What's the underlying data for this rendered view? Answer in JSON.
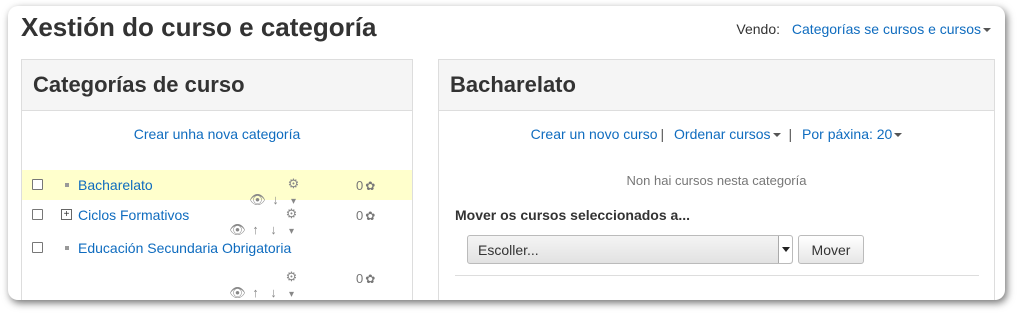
{
  "page": {
    "title": "Xestión do curso e categoría",
    "viewing_label": "Vendo:",
    "viewing_value": "Categorías se cursos e cursos"
  },
  "categories_panel": {
    "heading": "Categorías de curso",
    "create_link": "Crear unha nova categoría",
    "items": [
      {
        "name": "Bacharelato",
        "count": "0",
        "active": true,
        "expandable": false
      },
      {
        "name": "Ciclos Formativos",
        "count": "0",
        "active": false,
        "expandable": true
      },
      {
        "name": "Educación Secundaria Obrigatoria",
        "count": "0",
        "active": false,
        "expandable": false
      }
    ]
  },
  "courses_panel": {
    "heading": "Bacharelato",
    "create_course_link": "Crear un novo curso",
    "sort_courses_link": "Ordenar cursos",
    "per_page_link": "Por páxina: 20",
    "separator": "|",
    "empty_message": "Non hai cursos nesta categoría",
    "move_label": "Mover os cursos seleccionados a...",
    "select_value": "Escoller...",
    "move_button": "Mover"
  },
  "icons": {
    "show": "eye-icon",
    "up": "arrow-up-icon",
    "down": "arrow-down-icon",
    "settings": "gear-icon",
    "course_count": "courses-icon",
    "expand": "plus-box-icon"
  },
  "colors": {
    "link": "#0f6cbf",
    "active_row": "#ffffcc",
    "panel_header": "#f5f5f5"
  }
}
